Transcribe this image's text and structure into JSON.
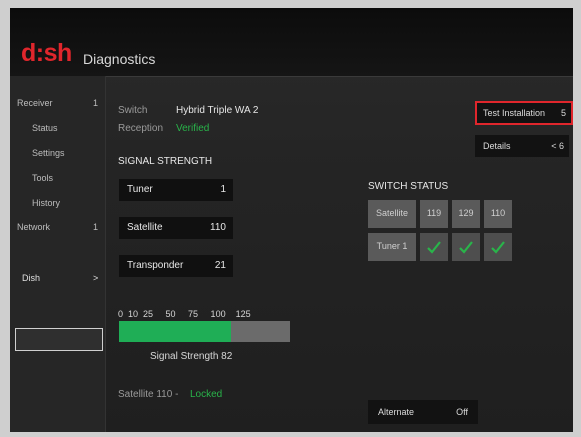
{
  "header": {
    "logo_prefix": "d",
    "logo_dots": ":",
    "logo_suffix": "sh",
    "subtitle": "Diagnostics"
  },
  "sidebar": {
    "items": [
      {
        "label": "Receiver",
        "arrow": "1"
      },
      {
        "label": "Status",
        "arrow": ""
      },
      {
        "label": "Settings",
        "arrow": ""
      },
      {
        "label": "Tools",
        "arrow": ""
      },
      {
        "label": "History",
        "arrow": ""
      },
      {
        "label": "Network",
        "arrow": "1"
      },
      {
        "label": "Dish",
        "arrow": ">"
      }
    ],
    "selected_index": 6
  },
  "info": {
    "switch_label": "Switch",
    "switch_value": "Hybrid Triple WA 2",
    "reception_label": "Reception",
    "reception_value": "Verified"
  },
  "signal": {
    "heading": "SIGNAL STRENGTH",
    "rows": [
      {
        "label": "Tuner",
        "value": "1"
      },
      {
        "label": "Satellite",
        "value": "110"
      },
      {
        "label": "Transponder",
        "value": "21"
      }
    ],
    "scale": "0  10  25     50     75     100    125",
    "strength_value": 82,
    "strength_max": 125,
    "strength_text": "Signal Strength 82",
    "locked_label": "Satellite 110 -",
    "locked_value": "Locked"
  },
  "switch_status": {
    "heading": "SWITCH STATUS",
    "header_label": "Satellite",
    "columns": [
      "119",
      "129",
      "110"
    ],
    "row_label": "Tuner 1",
    "checks": [
      true,
      true,
      true
    ]
  },
  "controls": {
    "test_label": "Test Installation",
    "test_value": "5",
    "details_label": "Details",
    "details_value": "< 6",
    "alternate_label": "Alternate",
    "alternate_value": "Off"
  },
  "colors": {
    "brand_red": "#e0262c",
    "ok_green": "#29b44a"
  }
}
